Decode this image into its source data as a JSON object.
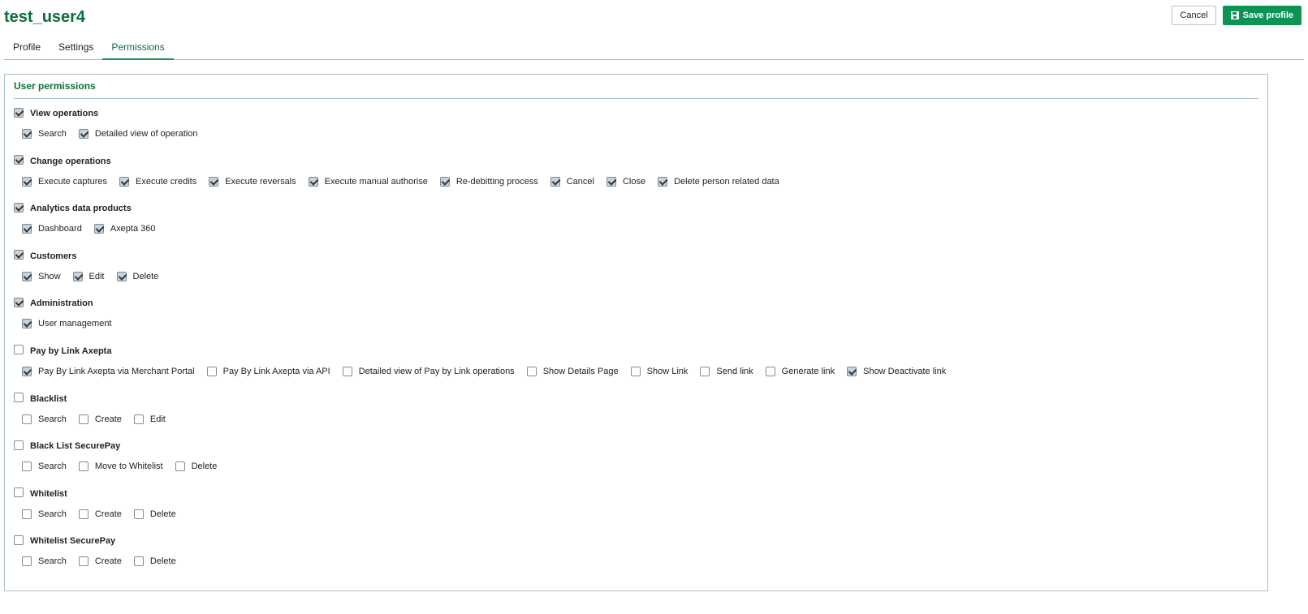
{
  "header": {
    "title": "test_user4",
    "cancel_label": "Cancel",
    "save_label": "Save profile"
  },
  "tabs": [
    {
      "label": "Profile",
      "active": false
    },
    {
      "label": "Settings",
      "active": false
    },
    {
      "label": "Permissions",
      "active": true
    }
  ],
  "panel": {
    "title": "User permissions",
    "groups": [
      {
        "label": "View operations",
        "checked": true,
        "items": [
          {
            "label": "Search",
            "checked": true
          },
          {
            "label": "Detailed view of operation",
            "checked": true
          }
        ]
      },
      {
        "label": "Change operations",
        "checked": true,
        "items": [
          {
            "label": "Execute captures",
            "checked": true
          },
          {
            "label": "Execute credits",
            "checked": true
          },
          {
            "label": "Execute reversals",
            "checked": true
          },
          {
            "label": "Execute manual authorise",
            "checked": true
          },
          {
            "label": "Re-debitting process",
            "checked": true
          },
          {
            "label": "Cancel",
            "checked": true
          },
          {
            "label": "Close",
            "checked": true
          },
          {
            "label": "Delete person related data",
            "checked": true
          }
        ]
      },
      {
        "label": "Analytics data products",
        "checked": true,
        "items": [
          {
            "label": "Dashboard",
            "checked": true
          },
          {
            "label": "Axepta 360",
            "checked": true
          }
        ]
      },
      {
        "label": "Customers",
        "checked": true,
        "items": [
          {
            "label": "Show",
            "checked": true
          },
          {
            "label": "Edit",
            "checked": true
          },
          {
            "label": "Delete",
            "checked": true
          }
        ]
      },
      {
        "label": "Administration",
        "checked": true,
        "items": [
          {
            "label": "User management",
            "checked": true
          }
        ]
      },
      {
        "label": "Pay by Link Axepta",
        "checked": false,
        "items": [
          {
            "label": "Pay By Link Axepta via Merchant Portal",
            "checked": true
          },
          {
            "label": "Pay By Link Axepta via API",
            "checked": false
          },
          {
            "label": "Detailed view of Pay by Link operations",
            "checked": false
          },
          {
            "label": "Show Details Page",
            "checked": false
          },
          {
            "label": "Show Link",
            "checked": false
          },
          {
            "label": "Send link",
            "checked": false
          },
          {
            "label": "Generate link",
            "checked": false
          },
          {
            "label": "Show Deactivate link",
            "checked": true
          }
        ]
      },
      {
        "label": "Blacklist",
        "checked": false,
        "items": [
          {
            "label": "Search",
            "checked": false
          },
          {
            "label": "Create",
            "checked": false
          },
          {
            "label": "Edit",
            "checked": false
          }
        ]
      },
      {
        "label": "Black List SecurePay",
        "checked": false,
        "items": [
          {
            "label": "Search",
            "checked": false
          },
          {
            "label": "Move to Whitelist",
            "checked": false
          },
          {
            "label": "Delete",
            "checked": false
          }
        ]
      },
      {
        "label": "Whitelist",
        "checked": false,
        "items": [
          {
            "label": "Search",
            "checked": false
          },
          {
            "label": "Create",
            "checked": false
          },
          {
            "label": "Delete",
            "checked": false
          }
        ]
      },
      {
        "label": "Whitelist SecurePay",
        "checked": false,
        "items": [
          {
            "label": "Search",
            "checked": false
          },
          {
            "label": "Create",
            "checked": false
          },
          {
            "label": "Delete",
            "checked": false
          }
        ]
      }
    ]
  },
  "icons": {
    "save": "floppy-disk-icon",
    "checkbox_checked": "checkmark-icon"
  },
  "colors": {
    "brand_green": "#0b6e3a",
    "button_green": "#0c9455",
    "border": "#a9bfcc"
  }
}
